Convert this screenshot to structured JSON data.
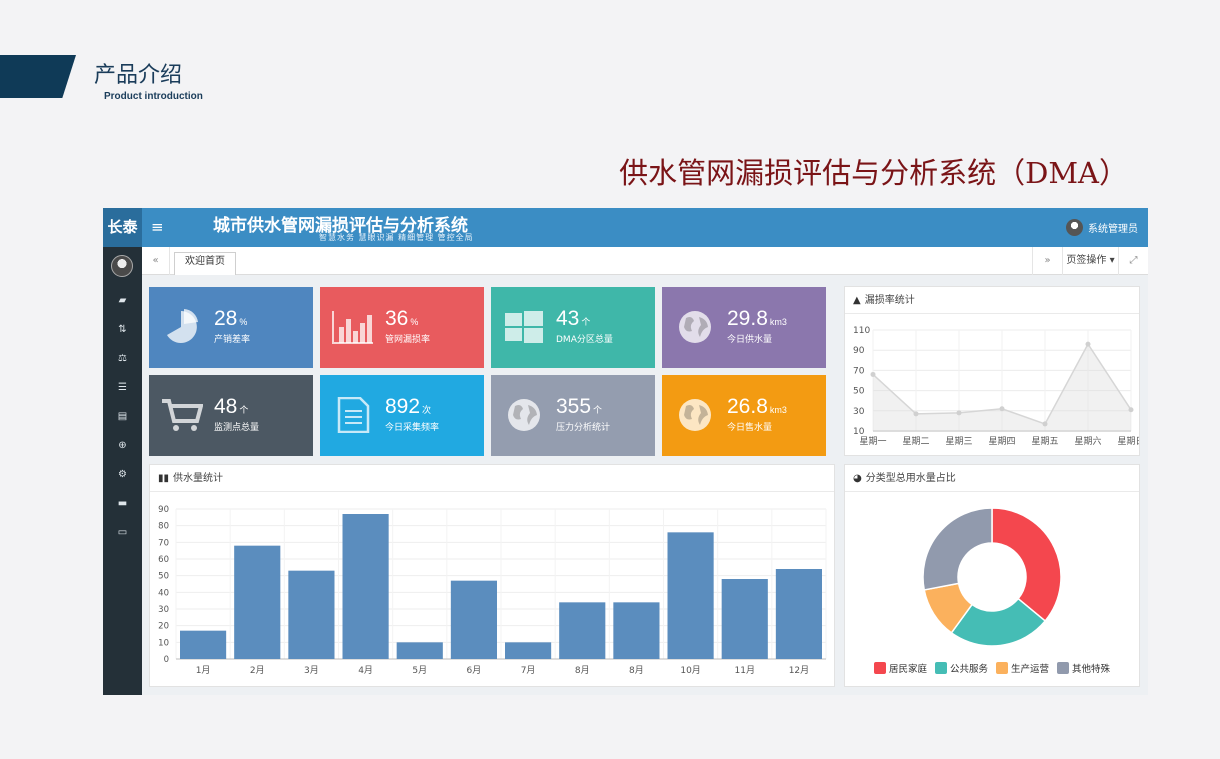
{
  "slide": {
    "section_title": "产品介绍",
    "section_subtitle": "Product  introduction",
    "main_title": "供水管网漏损评估与分析系统（DMA）"
  },
  "app": {
    "logo": "长泰",
    "title": "城市供水管网漏损评估与分析系统",
    "slogan": "智慧水务  慧眼识漏  精细管理  管控全局",
    "user": "系统管理员",
    "tabs": {
      "home": "欢迎首页",
      "ops": "页签操作"
    }
  },
  "sidebar_icons": [
    "book-icon",
    "sort-icon",
    "balance-icon",
    "list-icon",
    "document-icon",
    "search-icon",
    "gears-icon",
    "layers-icon",
    "monitor-icon"
  ],
  "stats": [
    {
      "value": "28",
      "unit": "%",
      "label": "产销差率",
      "color": "#4f86bf",
      "icon": "pie-icon"
    },
    {
      "value": "36",
      "unit": "%",
      "label": "管网漏损率",
      "color": "#e85b5e",
      "icon": "bar-icon"
    },
    {
      "value": "43",
      "unit": "个",
      "label": "DMA分区总量",
      "color": "#3fb7a9",
      "icon": "windows-icon"
    },
    {
      "value": "29.8",
      "unit": "km3",
      "label": "今日供水量",
      "color": "#8b77ad",
      "icon": "globe-icon"
    },
    {
      "value": "48",
      "unit": "个",
      "label": "监测点总量",
      "color": "#4c5863",
      "icon": "cart-icon"
    },
    {
      "value": "892",
      "unit": "次",
      "label": "今日采集频率",
      "color": "#21a9e1",
      "icon": "file-icon"
    },
    {
      "value": "355",
      "unit": "个",
      "label": "压力分析统计",
      "color": "#949daf",
      "icon": "globe-icon"
    },
    {
      "value": "26.8",
      "unit": "km3",
      "label": "今日售水量",
      "color": "#f39b12",
      "icon": "globe-icon"
    }
  ],
  "chart_data": [
    {
      "type": "line",
      "title": "漏损率统计",
      "categories": [
        "星期一",
        "星期二",
        "星期三",
        "星期四",
        "星期五",
        "星期六",
        "星期日"
      ],
      "values": [
        66,
        27,
        28,
        32,
        17,
        96,
        31
      ],
      "ylim": [
        10,
        110
      ],
      "yticks": [
        10,
        30,
        50,
        70,
        90,
        110
      ],
      "grid": true
    },
    {
      "type": "bar",
      "title": "供水量统计",
      "categories": [
        "1月",
        "2月",
        "3月",
        "4月",
        "5月",
        "6月",
        "7月",
        "8月",
        "8月",
        "10月",
        "11月",
        "12月"
      ],
      "values": [
        17,
        68,
        53,
        87,
        10,
        47,
        10,
        34,
        34,
        76,
        48,
        54
      ],
      "ylim": [
        0,
        90
      ],
      "yticks": [
        0,
        10,
        20,
        30,
        40,
        50,
        60,
        70,
        80,
        90
      ],
      "grid": true,
      "color": "#5b8dbe"
    },
    {
      "type": "pie",
      "title": "分类型总用水量占比",
      "labels": [
        "居民家庭",
        "公共服务",
        "生产运营",
        "其他特殊"
      ],
      "values": [
        36,
        24,
        12,
        28
      ],
      "colors": [
        "#f4474e",
        "#45bdb5",
        "#fbb15d",
        "#919aad"
      ],
      "legend": "bottom"
    }
  ]
}
